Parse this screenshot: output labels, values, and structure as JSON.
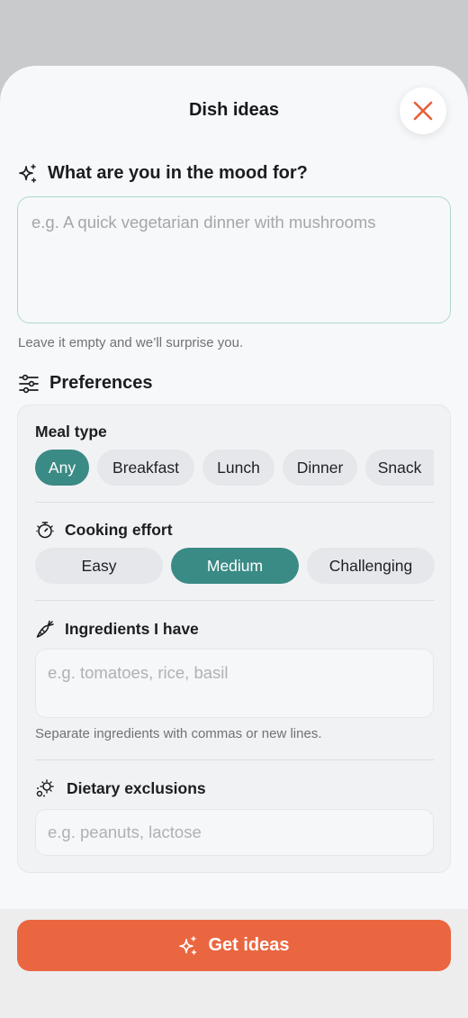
{
  "header": {
    "title": "Dish ideas"
  },
  "mood": {
    "heading": "What are you in the mood for?",
    "placeholder": "e.g. A quick vegetarian dinner with mushrooms",
    "hint": "Leave it empty and we’ll surprise you."
  },
  "preferences": {
    "heading": "Preferences",
    "meal_type": {
      "label": "Meal type",
      "options": [
        "Any",
        "Breakfast",
        "Lunch",
        "Dinner",
        "Snack"
      ],
      "selected": "Any"
    },
    "cooking_effort": {
      "label": "Cooking effort",
      "options": [
        "Easy",
        "Medium",
        "Challenging"
      ],
      "selected": "Medium"
    },
    "ingredients": {
      "label": "Ingredients I have",
      "placeholder": "e.g. tomatoes, rice, basil",
      "hint": "Separate ingredients with commas or new lines."
    },
    "dietary": {
      "label": "Dietary exclusions",
      "placeholder": "e.g. peanuts, lactose"
    }
  },
  "cta": {
    "label": "Get ideas"
  },
  "colors": {
    "accent": "#3a8a85",
    "cta": "#ea6640",
    "close_icon": "#e8603c"
  },
  "icons": {
    "close": "close-icon",
    "mood": "sparkles-icon",
    "preferences": "sliders-icon",
    "effort": "timer-icon",
    "ingredients": "carrot-icon",
    "dietary": "no-allergen-icon",
    "cta": "sparkles-icon"
  }
}
